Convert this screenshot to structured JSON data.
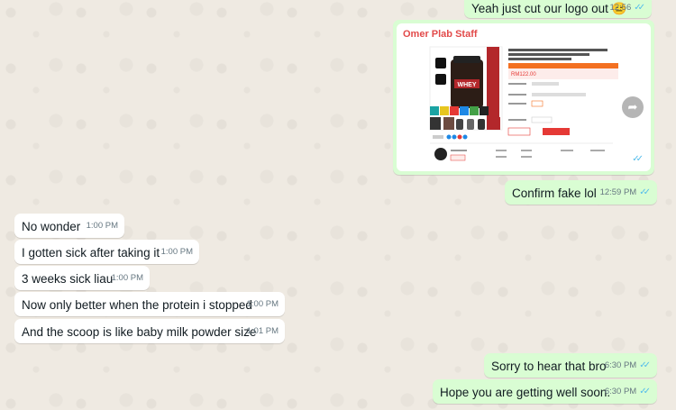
{
  "chat": {
    "messages": [
      {
        "dir": "out",
        "text": "Yeah just cut our logo out 😑",
        "time": "12:56"
      },
      {
        "dir": "out",
        "type": "image",
        "caption_title": "Omer Plab Staff",
        "time": "12:59 PM"
      },
      {
        "dir": "out",
        "text": "Confirm fake lol",
        "time": "12:59 PM"
      },
      {
        "dir": "in",
        "text": "No wonder",
        "time": "1:00 PM"
      },
      {
        "dir": "in",
        "text": "I gotten sick after taking it",
        "time": "1:00 PM"
      },
      {
        "dir": "in",
        "text": "3 weeks sick liau",
        "time": "1:00 PM"
      },
      {
        "dir": "in",
        "text": "Now only better when the protein i stopped",
        "time": "1:00 PM"
      },
      {
        "dir": "in",
        "text": "And the scoop is like baby milk powder size",
        "time": "1:01 PM"
      },
      {
        "dir": "out",
        "text": "Sorry to hear that bro",
        "time": "6:30 PM"
      },
      {
        "dir": "out",
        "text": "Hope you are getting well soon.",
        "time": "6:30 PM"
      }
    ]
  },
  "image_card": {
    "product_title": "Optimum Nutrition Gold Standard 100% Whey Protein Powder/Chocolate/2Lbs/Muscle Building, Lean Muscle",
    "price": "RM122.00",
    "buy_label": "Buy Now",
    "side_label": "Gold Standard Whey",
    "tub_label": "WHEY"
  },
  "icons": {
    "read_receipt": "double-check-icon",
    "forward": "forward-icon"
  },
  "colors": {
    "outgoing": "#d9fdd3",
    "incoming": "#ffffff",
    "background": "#efeae2",
    "read_tick": "#53bdeb",
    "card_title": "#e24a4a"
  }
}
